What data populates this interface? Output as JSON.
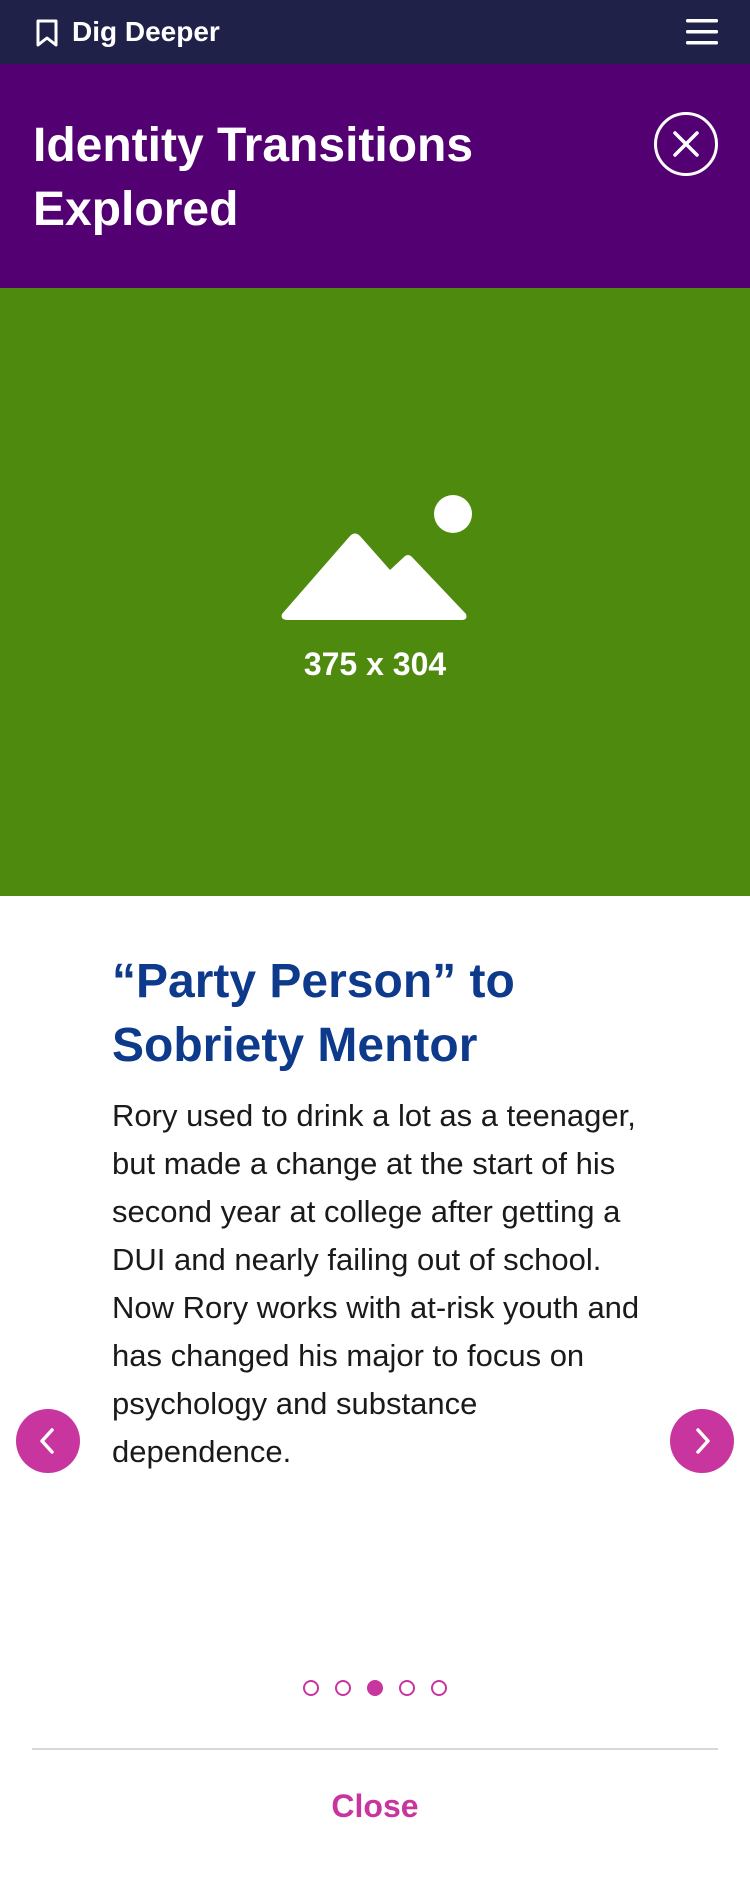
{
  "topbar": {
    "brand": "Dig Deeper",
    "bookmark_icon": "bookmark-icon",
    "menu_icon": "hamburger-menu-icon"
  },
  "header": {
    "title": "Identity Transitions Explored",
    "close_icon": "close-icon"
  },
  "hero": {
    "placeholder_icon": "image-placeholder-icon",
    "dimensions_label": "375 x 304"
  },
  "slide": {
    "title": "“Party Person” to Sobriety Mentor",
    "body": "Rory used to drink a lot as a teenager, but made a change at the start of his second year at college after getting a DUI and nearly failing out of school. Now Rory works with at-risk youth and has changed his major to focus on psychology and substance dependence."
  },
  "carousel": {
    "prev_icon": "chevron-left-icon",
    "next_icon": "chevron-right-icon",
    "total_slides": 5,
    "active_index": 3
  },
  "footer": {
    "close_label": "Close"
  },
  "colors": {
    "topbar": "#1f2149",
    "header": "#530072",
    "hero": "#4e8a0e",
    "title_blue": "#0e3a8c",
    "accent_magenta": "#c8359e"
  }
}
